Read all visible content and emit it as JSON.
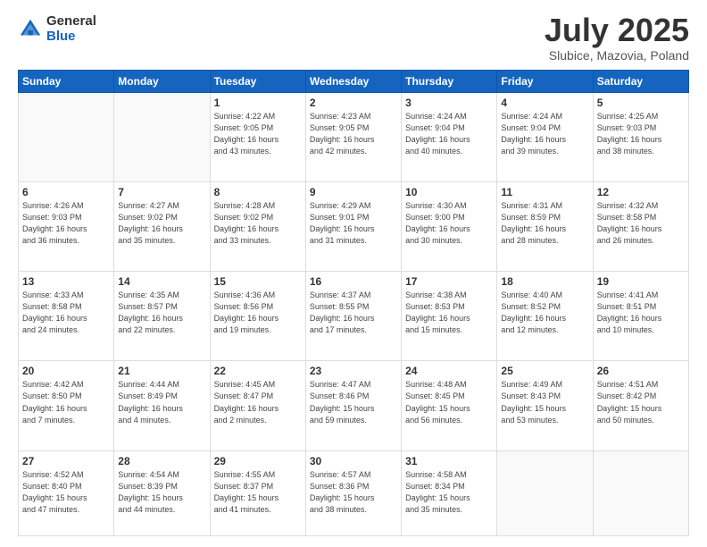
{
  "logo": {
    "general": "General",
    "blue": "Blue"
  },
  "header": {
    "month_year": "July 2025",
    "location": "Slubice, Mazovia, Poland"
  },
  "days_of_week": [
    "Sunday",
    "Monday",
    "Tuesday",
    "Wednesday",
    "Thursday",
    "Friday",
    "Saturday"
  ],
  "weeks": [
    [
      {
        "day": "",
        "info": ""
      },
      {
        "day": "",
        "info": ""
      },
      {
        "day": "1",
        "info": "Sunrise: 4:22 AM\nSunset: 9:05 PM\nDaylight: 16 hours\nand 43 minutes."
      },
      {
        "day": "2",
        "info": "Sunrise: 4:23 AM\nSunset: 9:05 PM\nDaylight: 16 hours\nand 42 minutes."
      },
      {
        "day": "3",
        "info": "Sunrise: 4:24 AM\nSunset: 9:04 PM\nDaylight: 16 hours\nand 40 minutes."
      },
      {
        "day": "4",
        "info": "Sunrise: 4:24 AM\nSunset: 9:04 PM\nDaylight: 16 hours\nand 39 minutes."
      },
      {
        "day": "5",
        "info": "Sunrise: 4:25 AM\nSunset: 9:03 PM\nDaylight: 16 hours\nand 38 minutes."
      }
    ],
    [
      {
        "day": "6",
        "info": "Sunrise: 4:26 AM\nSunset: 9:03 PM\nDaylight: 16 hours\nand 36 minutes."
      },
      {
        "day": "7",
        "info": "Sunrise: 4:27 AM\nSunset: 9:02 PM\nDaylight: 16 hours\nand 35 minutes."
      },
      {
        "day": "8",
        "info": "Sunrise: 4:28 AM\nSunset: 9:02 PM\nDaylight: 16 hours\nand 33 minutes."
      },
      {
        "day": "9",
        "info": "Sunrise: 4:29 AM\nSunset: 9:01 PM\nDaylight: 16 hours\nand 31 minutes."
      },
      {
        "day": "10",
        "info": "Sunrise: 4:30 AM\nSunset: 9:00 PM\nDaylight: 16 hours\nand 30 minutes."
      },
      {
        "day": "11",
        "info": "Sunrise: 4:31 AM\nSunset: 8:59 PM\nDaylight: 16 hours\nand 28 minutes."
      },
      {
        "day": "12",
        "info": "Sunrise: 4:32 AM\nSunset: 8:58 PM\nDaylight: 16 hours\nand 26 minutes."
      }
    ],
    [
      {
        "day": "13",
        "info": "Sunrise: 4:33 AM\nSunset: 8:58 PM\nDaylight: 16 hours\nand 24 minutes."
      },
      {
        "day": "14",
        "info": "Sunrise: 4:35 AM\nSunset: 8:57 PM\nDaylight: 16 hours\nand 22 minutes."
      },
      {
        "day": "15",
        "info": "Sunrise: 4:36 AM\nSunset: 8:56 PM\nDaylight: 16 hours\nand 19 minutes."
      },
      {
        "day": "16",
        "info": "Sunrise: 4:37 AM\nSunset: 8:55 PM\nDaylight: 16 hours\nand 17 minutes."
      },
      {
        "day": "17",
        "info": "Sunrise: 4:38 AM\nSunset: 8:53 PM\nDaylight: 16 hours\nand 15 minutes."
      },
      {
        "day": "18",
        "info": "Sunrise: 4:40 AM\nSunset: 8:52 PM\nDaylight: 16 hours\nand 12 minutes."
      },
      {
        "day": "19",
        "info": "Sunrise: 4:41 AM\nSunset: 8:51 PM\nDaylight: 16 hours\nand 10 minutes."
      }
    ],
    [
      {
        "day": "20",
        "info": "Sunrise: 4:42 AM\nSunset: 8:50 PM\nDaylight: 16 hours\nand 7 minutes."
      },
      {
        "day": "21",
        "info": "Sunrise: 4:44 AM\nSunset: 8:49 PM\nDaylight: 16 hours\nand 4 minutes."
      },
      {
        "day": "22",
        "info": "Sunrise: 4:45 AM\nSunset: 8:47 PM\nDaylight: 16 hours\nand 2 minutes."
      },
      {
        "day": "23",
        "info": "Sunrise: 4:47 AM\nSunset: 8:46 PM\nDaylight: 15 hours\nand 59 minutes."
      },
      {
        "day": "24",
        "info": "Sunrise: 4:48 AM\nSunset: 8:45 PM\nDaylight: 15 hours\nand 56 minutes."
      },
      {
        "day": "25",
        "info": "Sunrise: 4:49 AM\nSunset: 8:43 PM\nDaylight: 15 hours\nand 53 minutes."
      },
      {
        "day": "26",
        "info": "Sunrise: 4:51 AM\nSunset: 8:42 PM\nDaylight: 15 hours\nand 50 minutes."
      }
    ],
    [
      {
        "day": "27",
        "info": "Sunrise: 4:52 AM\nSunset: 8:40 PM\nDaylight: 15 hours\nand 47 minutes."
      },
      {
        "day": "28",
        "info": "Sunrise: 4:54 AM\nSunset: 8:39 PM\nDaylight: 15 hours\nand 44 minutes."
      },
      {
        "day": "29",
        "info": "Sunrise: 4:55 AM\nSunset: 8:37 PM\nDaylight: 15 hours\nand 41 minutes."
      },
      {
        "day": "30",
        "info": "Sunrise: 4:57 AM\nSunset: 8:36 PM\nDaylight: 15 hours\nand 38 minutes."
      },
      {
        "day": "31",
        "info": "Sunrise: 4:58 AM\nSunset: 8:34 PM\nDaylight: 15 hours\nand 35 minutes."
      },
      {
        "day": "",
        "info": ""
      },
      {
        "day": "",
        "info": ""
      }
    ]
  ]
}
